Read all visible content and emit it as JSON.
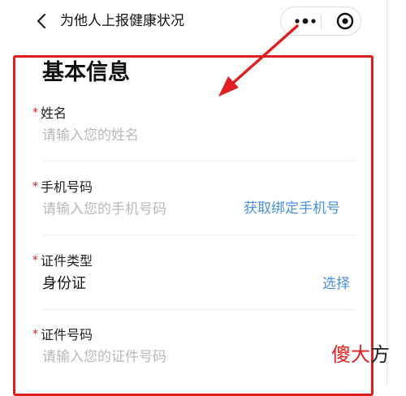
{
  "header": {
    "back_icon": "chevron-left-icon",
    "title": "为他人上报健康状况",
    "more_icon": "ellipsis-icon",
    "close_icon": "target-circle-icon"
  },
  "form": {
    "section_title": "基本信息",
    "required_mark": "*",
    "fields": [
      {
        "label": "姓名",
        "placeholder": "请输入您的姓名",
        "value": ""
      },
      {
        "label": "手机号码",
        "placeholder": "请输入您的手机号码",
        "value": "",
        "action": "获取绑定手机号"
      },
      {
        "label": "证件类型",
        "value": "身份证",
        "action": "选择"
      },
      {
        "label": "证件号码",
        "placeholder": "请输入您的证件号码",
        "value": ""
      }
    ]
  },
  "watermark": {
    "brand_main": "傻大",
    "brand_tail": "方"
  },
  "colors": {
    "accent": "#4a90e2",
    "required": "#e02020",
    "annotation": "#e02020"
  }
}
